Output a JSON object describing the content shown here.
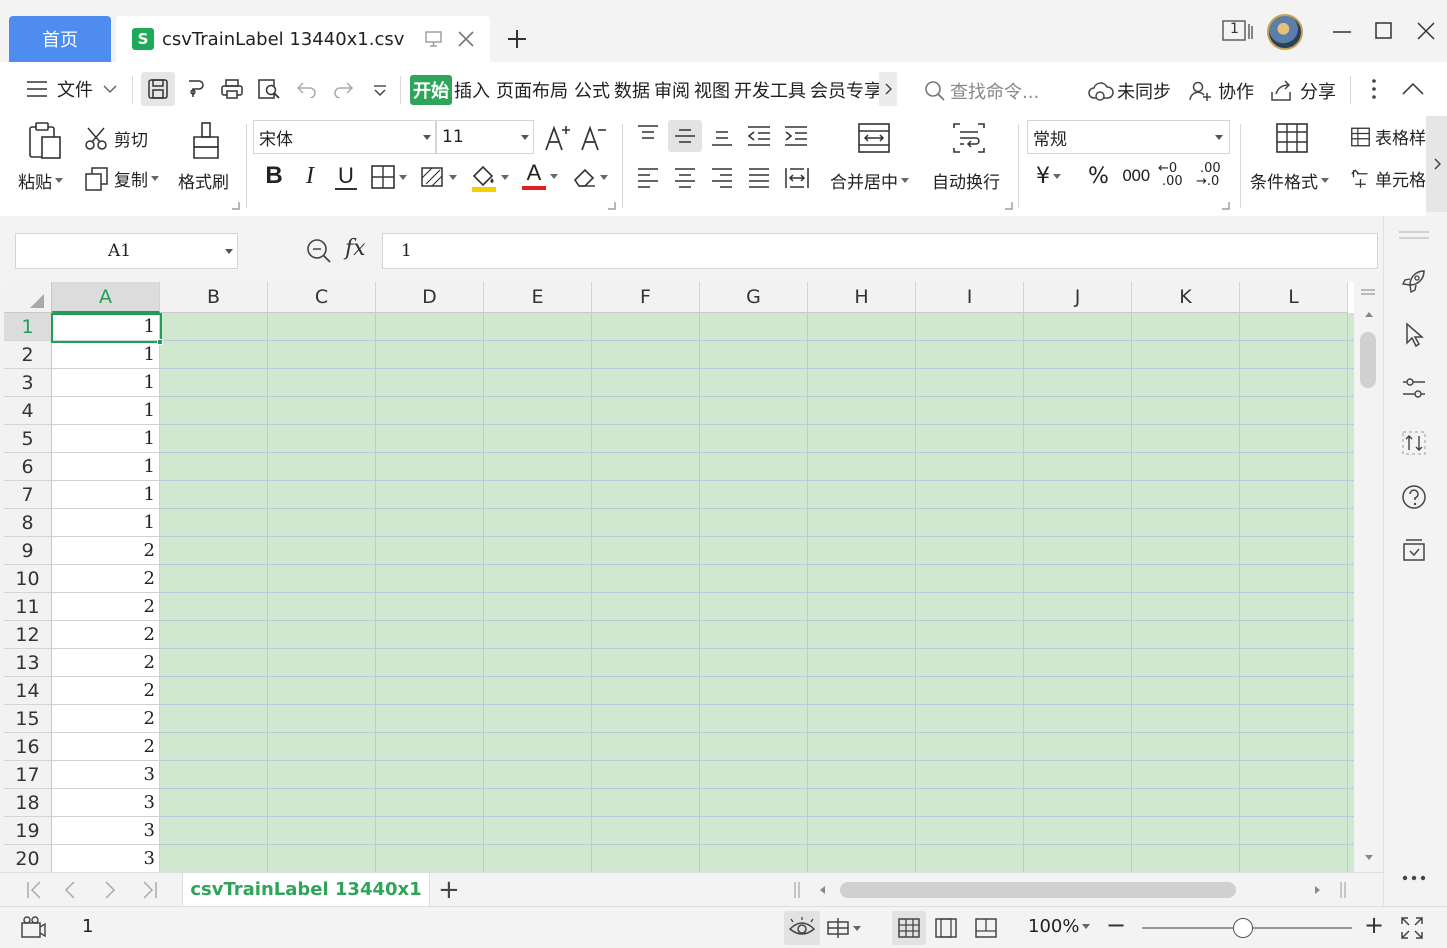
{
  "titlebar": {
    "home_tab": "首页",
    "doc_tab": "csvTrainLabel 13440x1.csv",
    "sheet_icon_letter": "S",
    "window_badge": "1"
  },
  "menubar": {
    "file_label": "文件",
    "tabs": [
      "开始",
      "插入",
      "页面布局",
      "公式",
      "数据",
      "审阅",
      "视图",
      "开发工具",
      "会员专享"
    ],
    "search_placeholder": "查找命令...",
    "sync": "未同步",
    "collab": "协作",
    "share": "分享"
  },
  "ribbon": {
    "paste": "粘贴",
    "cut": "剪切",
    "copy": "复制",
    "format_painter": "格式刷",
    "font_name": "宋体",
    "font_size": "11",
    "merge_center": "合并居中",
    "wrap_text": "自动换行",
    "number_format": "常规",
    "currency": "¥",
    "percent": "%",
    "thousands": "000",
    "inc_decimal_top": "←0",
    "inc_decimal_bottom": ".00",
    "dec_decimal_top": ".00",
    "dec_decimal_bottom": "→.0",
    "conditional_format": "条件格式",
    "table_style": "表格样",
    "cell_style": "单元格",
    "bold": "B",
    "italic": "I",
    "underline": "U",
    "font_color": "A"
  },
  "formula_bar": {
    "name_box": "A1",
    "fx": "fx",
    "value": "1"
  },
  "grid": {
    "columns": [
      "A",
      "B",
      "C",
      "D",
      "E",
      "F",
      "G",
      "H",
      "I",
      "J",
      "K",
      "L"
    ],
    "rows": [
      "1",
      "2",
      "3",
      "4",
      "5",
      "6",
      "7",
      "8",
      "9",
      "10",
      "11",
      "12",
      "13",
      "14",
      "15",
      "16",
      "17",
      "18",
      "19",
      "20"
    ],
    "colA_values": [
      "1",
      "1",
      "1",
      "1",
      "1",
      "1",
      "1",
      "1",
      "2",
      "2",
      "2",
      "2",
      "2",
      "2",
      "2",
      "2",
      "3",
      "3",
      "3",
      "3"
    ]
  },
  "sheets": {
    "active": "csvTrainLabel 13440x1",
    "add": "+"
  },
  "status": {
    "count": "1",
    "zoom": "100%",
    "minus": "−",
    "plus": "+"
  },
  "colors": {
    "home_tab_bg": "#4e8cf0",
    "active_tab_green": "#2ea55a",
    "grid_fill": "#cfe8cf",
    "selection": "#1e9e57"
  }
}
